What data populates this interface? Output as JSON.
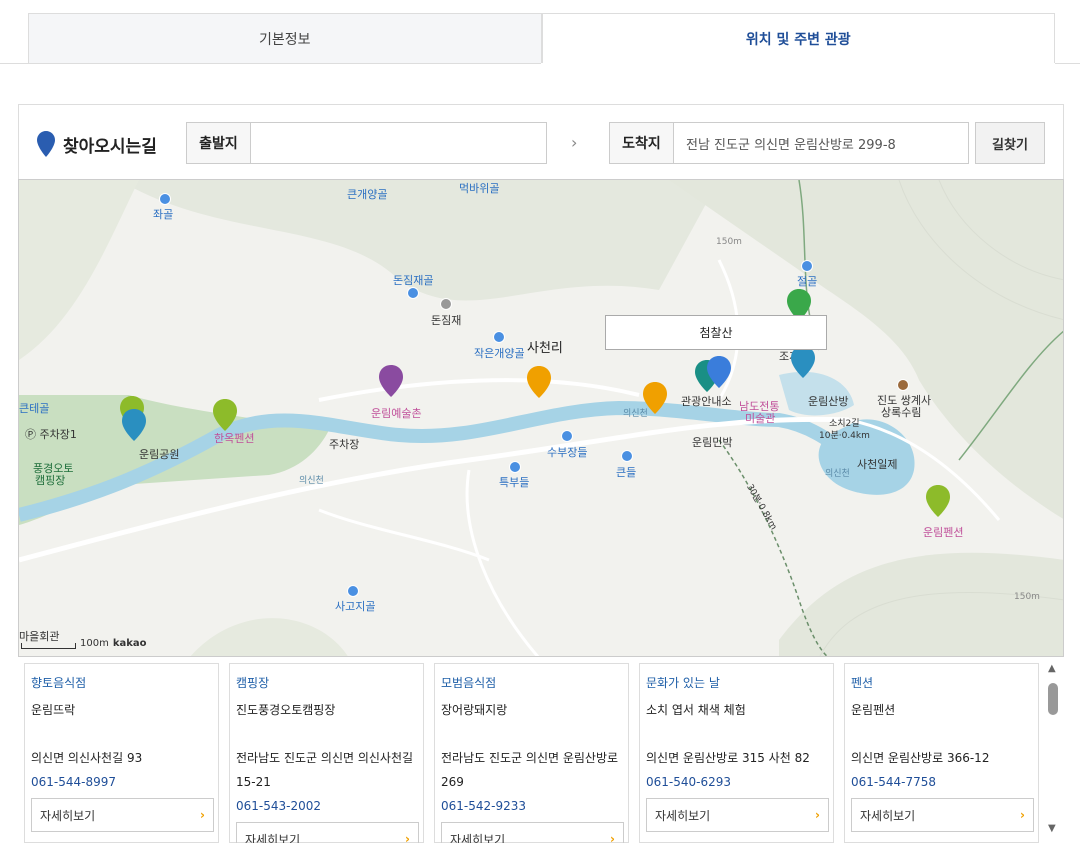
{
  "tabs": [
    {
      "label": "기본정보",
      "active": false
    },
    {
      "label": "위치 및 주변 관광",
      "active": true
    }
  ],
  "route": {
    "title": "찾아오시는길",
    "origin_label": "출발지",
    "origin_value": "",
    "destination_label": "도착지",
    "destination_value": "전남 진도군 의신면 운림산방로 299-8",
    "find_button": "길찾기"
  },
  "map": {
    "popup": "첨찰산",
    "scale_text": "100m",
    "provider": "kakao",
    "labels": {
      "keungaeyang": "큰개양골",
      "meokbawi": "먹바위골",
      "jwagol": "좌골",
      "donjimjae_gol": "돈짐재골",
      "donjimjae": "돈짐재",
      "jageungaeyang": "작은개양골",
      "sacheonri": "사천리",
      "jeolgol": "절골",
      "elev150": "150m",
      "elev150b": "150m",
      "keunteogol": "큰테골",
      "parking1": "주차장1",
      "pungyeong": "풍경오토",
      "camping": "캠핑장",
      "unrimpark": "운림공원",
      "hanok": "한옥펜션",
      "parking": "주차장",
      "unrimart": "운림예술촌",
      "sabujangdeul": "수부장들",
      "teukbudeul": "특부들",
      "keundeul": "큰들",
      "tourinfo": "관광안내소",
      "namdo": "남도전통",
      "museum": "미술관",
      "unrimminbak": "운림민박",
      "unrimsanbang": "운림산방",
      "ssanggyesa": "조계사",
      "jindo_ssanggye": "진도 쌍계사",
      "forest": "상록수림",
      "sacheonje": "사천일제",
      "sochi": "소치2길",
      "unrimpension": "운림펜션",
      "sagojigol": "사고지골",
      "hall": "마을회관",
      "uisincheon": "의신천",
      "uisincheon2": "의신천",
      "uisincheon3": "의신천",
      "trail1": "30분·0.8km",
      "trail2": "10분·0.4km"
    }
  },
  "cards": [
    {
      "category": "향토음식점",
      "name": "운림뜨락",
      "address": "의신면 의신사천길 93",
      "phone": "061-544-8997",
      "more": "자세히보기"
    },
    {
      "category": "캠핑장",
      "name": "진도풍경오토캠핑장",
      "address": "전라남도 진도군 의신면 의신사천길 15-21",
      "phone": "061-543-2002",
      "more": "자세히보기"
    },
    {
      "category": "모범음식점",
      "name": "장어랑돼지랑",
      "address": "전라남도 진도군 의신면 운림산방로 269",
      "phone": "061-542-9233",
      "more": "자세히보기"
    },
    {
      "category": "문화가 있는 날",
      "name": "소치 엽서 채색 체험",
      "address": "의신면 운림산방로 315 사천 82",
      "phone": "061-540-6293",
      "more": "자세히보기"
    },
    {
      "category": "펜션",
      "name": "운림펜션",
      "address": "의신면 운림산방로 366-12",
      "phone": "061-544-7758",
      "more": "자세히보기"
    }
  ],
  "colors": {
    "accent": "#1f4e98",
    "river": "#a6d3e6",
    "park": "#c9dfc1",
    "arrow": "#f0a000"
  }
}
